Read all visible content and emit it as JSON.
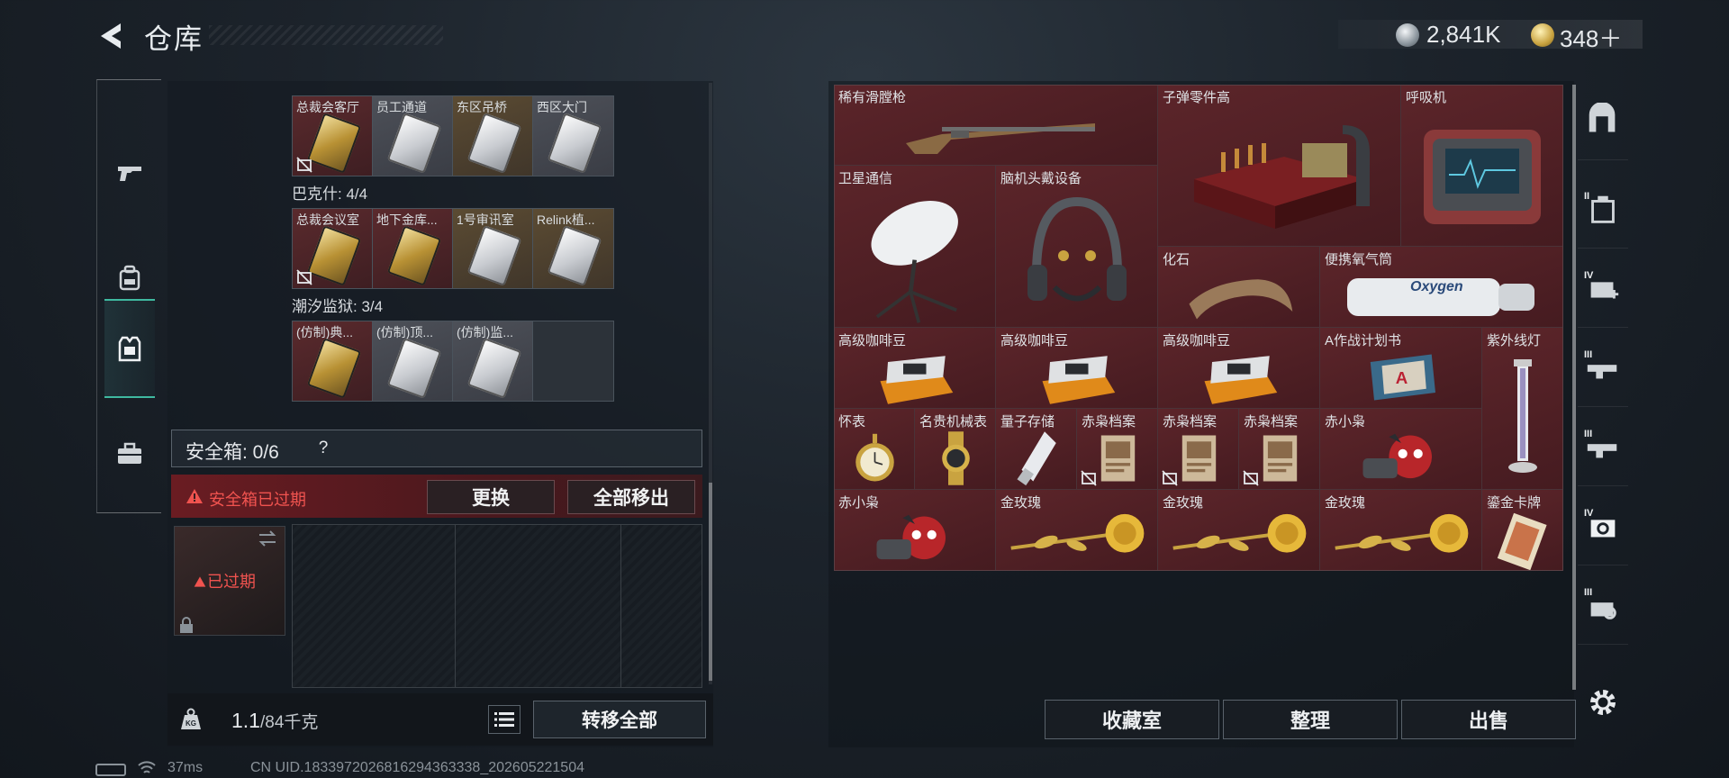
{
  "header": {
    "title": "仓库",
    "currency": [
      {
        "icon": "silver-coin-icon",
        "value": "2,841K"
      },
      {
        "icon": "gold-coin-icon",
        "value": "348＋"
      }
    ]
  },
  "left_tabs": [
    "pistol-icon",
    "backpack-icon",
    "vest-icon",
    "toolbox-icon"
  ],
  "key_groups": [
    {
      "title": "",
      "cards": [
        {
          "label": "总裁会客厅",
          "color": "red",
          "key": "gold",
          "no_sell": true
        },
        {
          "label": "员工通道",
          "color": "white",
          "key": "white",
          "no_sell": false
        },
        {
          "label": "东区吊桥",
          "color": "gold",
          "key": "white",
          "no_sell": false
        },
        {
          "label": "西区大门",
          "color": "white",
          "key": "white",
          "no_sell": false
        }
      ]
    },
    {
      "title": "巴克什: 4/4",
      "cards": [
        {
          "label": "总裁会议室",
          "color": "red",
          "key": "gold",
          "no_sell": true
        },
        {
          "label": "地下金库...",
          "color": "red",
          "key": "gold",
          "no_sell": false
        },
        {
          "label": "1号审讯室",
          "color": "gold",
          "key": "white",
          "no_sell": false
        },
        {
          "label": "Relink植...",
          "color": "gold",
          "key": "white",
          "no_sell": false
        }
      ]
    },
    {
      "title": "潮汐监狱: 3/4",
      "cards": [
        {
          "label": "(仿制)典...",
          "color": "red",
          "key": "gold",
          "no_sell": false
        },
        {
          "label": "(仿制)顶...",
          "color": "white",
          "key": "white",
          "no_sell": false
        },
        {
          "label": "(仿制)监...",
          "color": "white",
          "key": "white",
          "no_sell": false
        },
        {
          "label": "",
          "color": "empty",
          "key": "",
          "no_sell": false
        }
      ]
    }
  ],
  "safe_box": {
    "title": "安全箱: 0/6",
    "help": "?",
    "expired_warning": "安全箱已过期",
    "replace_label": "更换",
    "move_all_label": "全部移出",
    "case_status": "已过期"
  },
  "bottom_left": {
    "weight": "1.1",
    "capacity": "/84千克",
    "transfer_label": "转移全部"
  },
  "status": {
    "ping": "37ms",
    "uid": "CN UID.1833972026816294363338_202605221504"
  },
  "items": [
    {
      "label": "稀有滑膛枪",
      "rarity": "red",
      "art": "musket"
    },
    {
      "label": "子弹零件高",
      "rarity": "red",
      "art": "crate"
    },
    {
      "label": "呼吸机",
      "rarity": "red",
      "art": "ventilator"
    },
    {
      "label": "卫星通信",
      "rarity": "red",
      "art": "dish"
    },
    {
      "label": "脑机头戴设备",
      "rarity": "red",
      "art": "headset"
    },
    {
      "label": "化石",
      "rarity": "red",
      "art": "fossil"
    },
    {
      "label": "便携氧气筒",
      "rarity": "red",
      "art": "oxygen"
    },
    {
      "label": "高级咖啡豆",
      "rarity": "red",
      "art": "coffee"
    },
    {
      "label": "高级咖啡豆",
      "rarity": "red",
      "art": "coffee"
    },
    {
      "label": "高级咖啡豆",
      "rarity": "red",
      "art": "coffee"
    },
    {
      "label": "A作战计划书",
      "rarity": "red",
      "art": "book"
    },
    {
      "label": "紫外线灯",
      "rarity": "red",
      "art": "uvlamp"
    },
    {
      "label": "怀表",
      "rarity": "red",
      "art": "pocketwatch"
    },
    {
      "label": "名贵机械表",
      "rarity": "red",
      "art": "watch"
    },
    {
      "label": "量子存储",
      "rarity": "red",
      "art": "usb"
    },
    {
      "label": "赤枭档案",
      "rarity": "red",
      "art": "file"
    },
    {
      "label": "赤枭档案",
      "rarity": "red",
      "art": "file"
    },
    {
      "label": "赤枭档案",
      "rarity": "red",
      "art": "file"
    },
    {
      "label": "赤小枭",
      "rarity": "red",
      "art": "owl"
    },
    {
      "label": "赤小枭",
      "rarity": "red",
      "art": "owl"
    },
    {
      "label": "金玫瑰",
      "rarity": "red",
      "art": "rose"
    },
    {
      "label": "金玫瑰",
      "rarity": "red",
      "art": "rose"
    },
    {
      "label": "金玫瑰",
      "rarity": "red",
      "art": "rose"
    },
    {
      "label": "鎏金卡牌",
      "rarity": "red",
      "art": "card"
    }
  ],
  "actions": {
    "collection_label": "收藏室",
    "sort_label": "整理",
    "sell_label": "出售"
  },
  "right_tabs": [
    {
      "icon": "map-tab-icon",
      "roman": ""
    },
    {
      "icon": "backpack-tab-icon",
      "roman": "II"
    },
    {
      "icon": "medkit-tab-icon",
      "roman": "IV"
    },
    {
      "icon": "rifle-tab-icon",
      "roman": "III"
    },
    {
      "icon": "rifle-tab-icon-2",
      "roman": "III"
    },
    {
      "icon": "camera-tab-icon",
      "roman": "IV"
    },
    {
      "icon": "gear-tab-icon",
      "roman": "III"
    }
  ],
  "colors": {
    "accent_teal": "#3fb9a0",
    "warning_red": "#f0534f",
    "rare_red": "#5c252a"
  }
}
